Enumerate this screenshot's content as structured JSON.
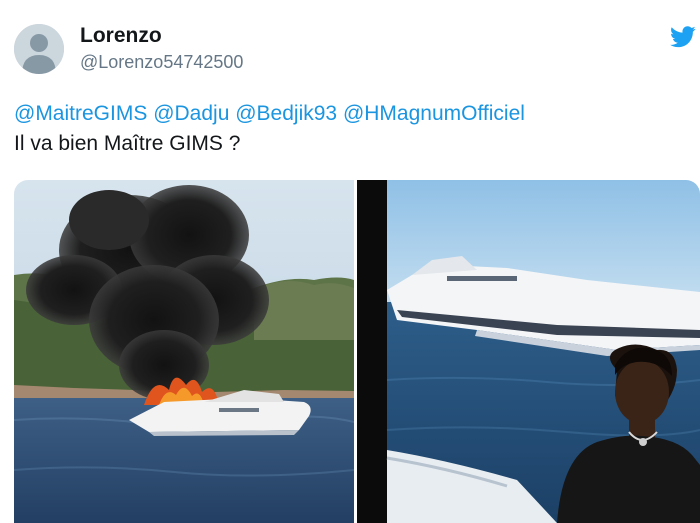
{
  "tweet": {
    "display_name": "Lorenzo",
    "handle": "@Lorenzo54742500",
    "mentions": [
      "@MaitreGIMS",
      "@Dadju",
      "@Bedjik93",
      "@HMagnumOfficiel"
    ],
    "text_line2": "Il va bien Maître GIMS ?"
  },
  "icons": {
    "avatar": "default-profile-icon",
    "brand": "twitter-bird-icon"
  },
  "colors": {
    "link": "#1b95e0",
    "brand": "#1da1f2",
    "secondary_text": "#657786"
  }
}
